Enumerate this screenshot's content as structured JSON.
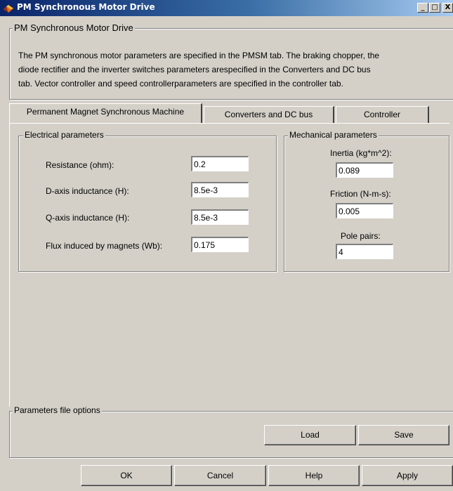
{
  "window": {
    "title": "PM Synchronous Motor Drive",
    "minimize": "_",
    "maximize": "□",
    "close": "X"
  },
  "description": {
    "group_title": "PM Synchronous Motor Drive",
    "line1": "The PM synchronous motor parameters are specified in the PMSM tab. The braking chopper, the",
    "line2": "diode rectifier and the inverter switches parameters arespecified in the Converters and DC bus",
    "line3": "tab. Vector controller and speed controllerparameters are specified in the controller tab."
  },
  "tabs": [
    {
      "label": "Permanent Magnet Synchronous Machine",
      "active": true
    },
    {
      "label": "Converters and DC bus",
      "active": false
    },
    {
      "label": "Controller",
      "active": false
    }
  ],
  "electrical": {
    "title": "Electrical parameters",
    "resistance_label": "Resistance (ohm):",
    "resistance_value": "0.2",
    "d_inductance_label": "D-axis inductance (H):",
    "d_inductance_value": "8.5e-3",
    "q_inductance_label": "Q-axis inductance (H):",
    "q_inductance_value": "8.5e-3",
    "flux_label": "Flux induced by magnets (Wb):",
    "flux_value": "0.175"
  },
  "mechanical": {
    "title": "Mechanical parameters",
    "inertia_label": "Inertia (kg*m^2):",
    "inertia_value": "0.089",
    "friction_label": "Friction (N-m-s):",
    "friction_value": "0.005",
    "pole_pairs_label": "Pole pairs:",
    "pole_pairs_value": "4"
  },
  "params_file": {
    "title": "Parameters file options",
    "load_label": "Load",
    "save_label": "Save"
  },
  "footer": {
    "ok_label": "OK",
    "cancel_label": "Cancel",
    "help_label": "Help",
    "apply_label": "Apply"
  }
}
